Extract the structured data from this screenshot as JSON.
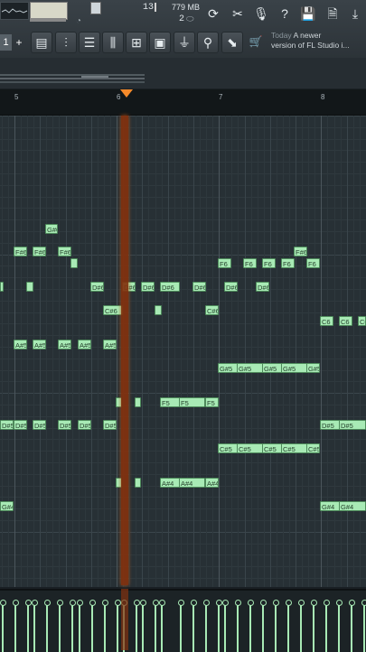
{
  "toolbar": {
    "cpu_value": "13",
    "poly_value": "2",
    "ram_label": "779 MB",
    "pattern_number": "1",
    "pattern_add": "+",
    "icons": [
      "undo-icon",
      "cut-tools-icon",
      "mic-icon",
      "help-icon",
      "save-icon",
      "save-as-icon",
      "download-icon",
      "mixer-icon",
      "channel-rack-icon",
      "playlist-icon",
      "piano-roll-icon",
      "plugin-icon",
      "browser-icon",
      "plug-icon",
      "record-icon",
      "audio-icon",
      "shop-icon"
    ],
    "help_glyph": "?"
  },
  "news": {
    "date": "Today",
    "line1": "A newer",
    "line2": "version of FL Studio i..."
  },
  "ruler": {
    "bars": [
      "5",
      "6",
      "7",
      "8"
    ]
  },
  "notes": [
    {
      "label": "G#6"
    },
    {
      "label": "F#6"
    },
    {
      "label": "F#6"
    },
    {
      "label": "F#6"
    },
    {
      "label": ""
    },
    {
      "label": "F6"
    },
    {
      "label": "F6"
    },
    {
      "label": "F6"
    },
    {
      "label": "F6"
    },
    {
      "label": "F6"
    },
    {
      "label": "F#6"
    },
    {
      "label": ""
    },
    {
      "label": ""
    },
    {
      "label": "D#6"
    },
    {
      "label": "D#6"
    },
    {
      "label": "D#6"
    },
    {
      "label": "D#6"
    },
    {
      "label": "D#6"
    },
    {
      "label": "D#6"
    },
    {
      "label": "D#6"
    },
    {
      "label": "C#6"
    },
    {
      "label": ""
    },
    {
      "label": "C#6"
    },
    {
      "label": "C6"
    },
    {
      "label": "C6"
    },
    {
      "label": "C6"
    },
    {
      "label": "A#5"
    },
    {
      "label": "A#5"
    },
    {
      "label": "A#5"
    },
    {
      "label": "A#5"
    },
    {
      "label": "A#5"
    },
    {
      "label": "G#5"
    },
    {
      "label": "G#5"
    },
    {
      "label": "G#5"
    },
    {
      "label": "G#5"
    },
    {
      "label": "G#5"
    },
    {
      "label": ""
    },
    {
      "label": ""
    },
    {
      "label": "F5"
    },
    {
      "label": "F5"
    },
    {
      "label": "F5"
    },
    {
      "label": "D#5"
    },
    {
      "label": "D#5"
    },
    {
      "label": "D#5"
    },
    {
      "label": "D#5"
    },
    {
      "label": "D#5"
    },
    {
      "label": "D#5"
    },
    {
      "label": "D#5"
    },
    {
      "label": "D#5"
    },
    {
      "label": "C#5"
    },
    {
      "label": "C#5"
    },
    {
      "label": "C#5"
    },
    {
      "label": "C#5"
    },
    {
      "label": "C#5"
    },
    {
      "label": ""
    },
    {
      "label": ""
    },
    {
      "label": "A#4"
    },
    {
      "label": "A#4"
    },
    {
      "label": "A#4"
    },
    {
      "label": "G#4"
    },
    {
      "label": "G#4"
    },
    {
      "label": "G#4"
    }
  ],
  "colors": {
    "note_fill": "#a8eab5",
    "playhead": "#83320f",
    "playhead_marker": "#f58a2a",
    "grid_bg": "#273035"
  }
}
